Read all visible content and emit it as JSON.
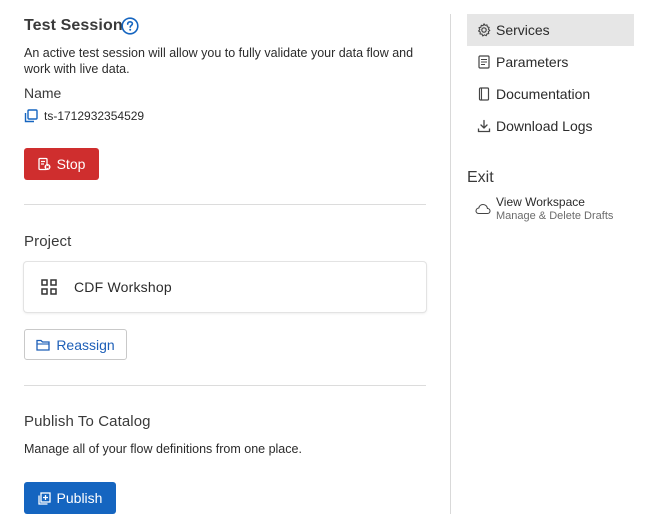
{
  "test_session": {
    "title": "Test Session",
    "description_line1": "An active test session will allow you to fully validate your data flow and",
    "description_line2": "work with live data.",
    "name_label": "Name",
    "session_id": "ts-1712932354529",
    "stop_label": "Stop"
  },
  "project": {
    "title": "Project",
    "name": "CDF Workshop",
    "reassign_label": "Reassign"
  },
  "publish": {
    "title": "Publish To Catalog",
    "description": "Manage all of your flow definitions from one place.",
    "publish_label": "Publish"
  },
  "sidebar": {
    "items": [
      {
        "label": "Services",
        "icon": "gear-icon",
        "active": true
      },
      {
        "label": "Parameters",
        "icon": "parameters-icon",
        "active": false
      },
      {
        "label": "Documentation",
        "icon": "documentation-icon",
        "active": false
      },
      {
        "label": "Download Logs",
        "icon": "download-icon",
        "active": false
      }
    ],
    "exit_title": "Exit",
    "workspace_label": "View Workspace",
    "workspace_sub": "Manage & Delete Drafts"
  },
  "colors": {
    "stop": "#cf2e2e",
    "primary": "#1565c0",
    "link": "#1d5fb8"
  }
}
